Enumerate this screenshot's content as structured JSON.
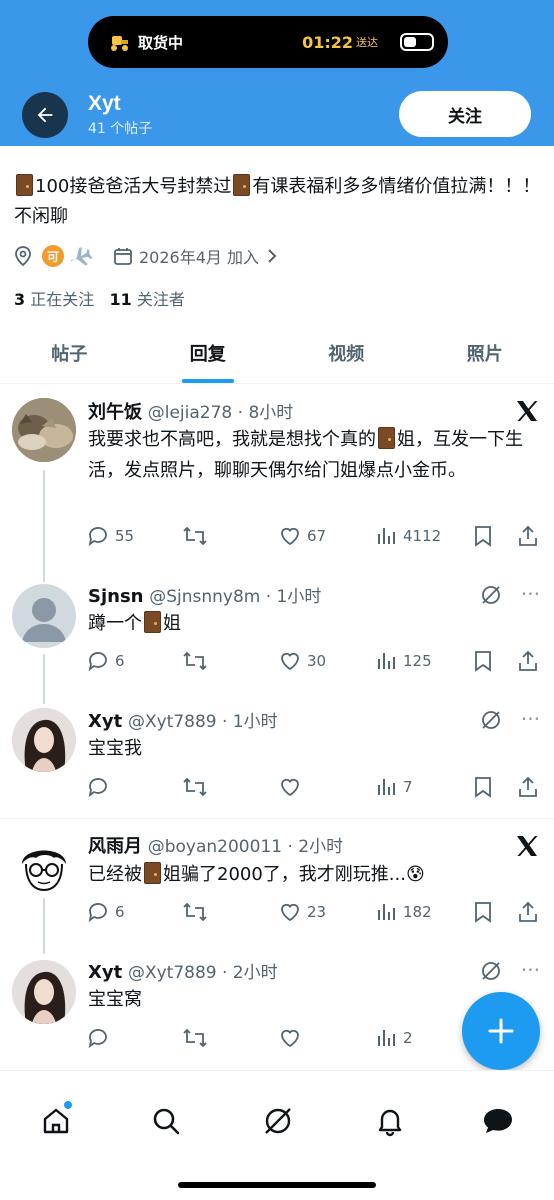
{
  "status": {
    "island_text": "取货中",
    "island_time": "01:22",
    "island_sub": "送达"
  },
  "header": {
    "name": "Xyt",
    "post_count": "41 个帖子",
    "follow_label": "关注"
  },
  "profile": {
    "bio_parts": [
      "100接爸爸活大号封禁过",
      "有课表福利多多情绪价值拉满！！！ 不闲聊"
    ],
    "badge_text": "可",
    "joined": "2026年4月 加入",
    "following_count": "3",
    "following_label": "正在关注",
    "followers_count": "11",
    "followers_label": "关注者"
  },
  "tabs": [
    "帖子",
    "回复",
    "视频",
    "照片"
  ],
  "posts": [
    {
      "name": "刘午饭",
      "meta": "@lejia278 · 8小时",
      "body_parts": [
        "我要求也不高吧，我就是想找个真的",
        "姐，互发一下生活，发点照片，聊聊天偶尔给门姐爆点小金币。"
      ],
      "replies": "55",
      "reposts": "",
      "likes": "67",
      "views": "4112"
    },
    {
      "name": "Sjnsn",
      "meta": "@Sjnsnny8m · 1小时",
      "body_parts": [
        "蹲一个",
        "姐"
      ],
      "replies": "6",
      "reposts": "",
      "likes": "30",
      "views": "125"
    },
    {
      "name": "Xyt",
      "meta": "@Xyt7889 · 1小时",
      "body_parts": [
        "宝宝我"
      ],
      "replies": "",
      "reposts": "",
      "likes": "",
      "views": "7"
    },
    {
      "name": "风雨月",
      "meta": "@boyan200011 · 2小时",
      "body_parts": [
        "已经被",
        "姐骗了2000了，我才刚玩推...😰"
      ],
      "replies": "6",
      "reposts": "",
      "likes": "23",
      "views": "182"
    },
    {
      "name": "Xyt",
      "meta": "@Xyt7889 · 2小时",
      "body_parts": [
        "宝宝窝"
      ],
      "replies": "",
      "reposts": "",
      "likes": "",
      "views": "2"
    }
  ],
  "colors": {
    "header_bg": "#3b97ea",
    "accent": "#1d9bf0",
    "text_secondary": "#536471"
  }
}
